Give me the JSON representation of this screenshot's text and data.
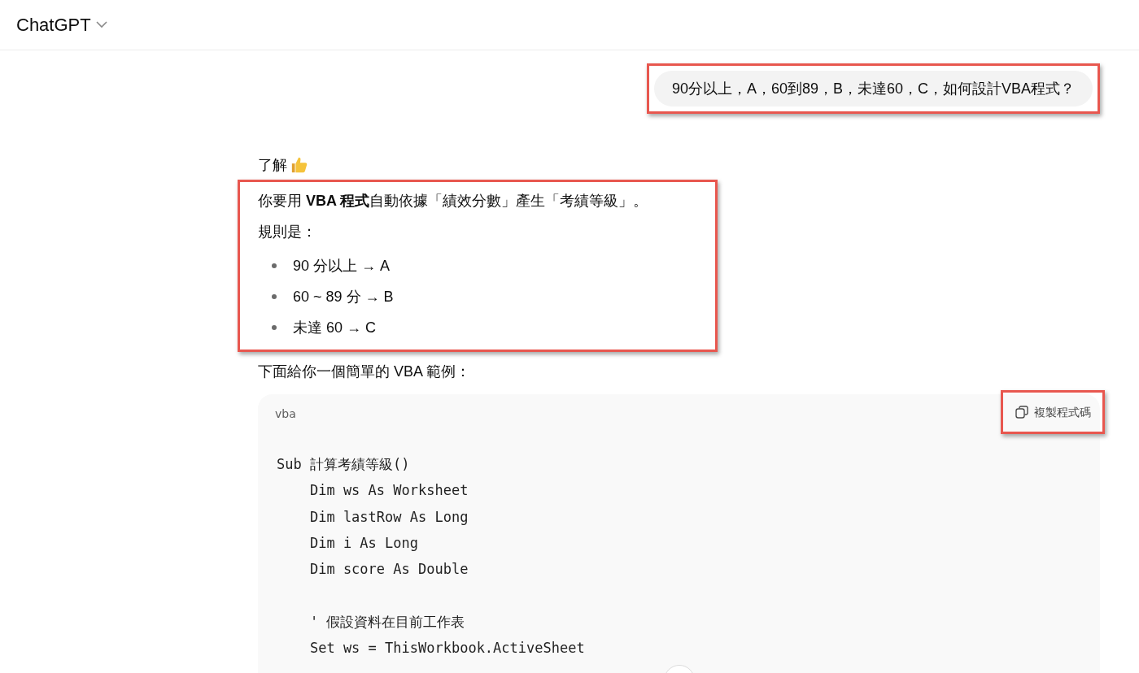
{
  "header": {
    "title": "ChatGPT"
  },
  "user_message": {
    "text": "90分以上，A，60到89，B，未達60，C，如何設計VBA程式？",
    "highlighted": true
  },
  "assistant": {
    "intro": "了解",
    "rules_block": {
      "highlighted": true,
      "paragraph": "你要用 **VBA 程式**自動依據「績效分數」產生「考績等級」。",
      "rules_label": "規則是：",
      "rules": [
        "90 分以上 → A",
        "60 ~ 89 分 → B",
        "未達 60 → C"
      ]
    },
    "lead": "下面給你一個簡單的 VBA 範例：",
    "code_block": {
      "language": "vba",
      "copy_button": {
        "label": "複製程式碼",
        "highlighted": true
      },
      "code": "Sub 計算考績等級()\n    Dim ws As Worksheet\n    Dim lastRow As Long\n    Dim i As Long\n    Dim score As Double\n\n    ' 假設資料在目前工作表\n    Set ws = ThisWorkbook.ActiveSheet"
    }
  }
}
